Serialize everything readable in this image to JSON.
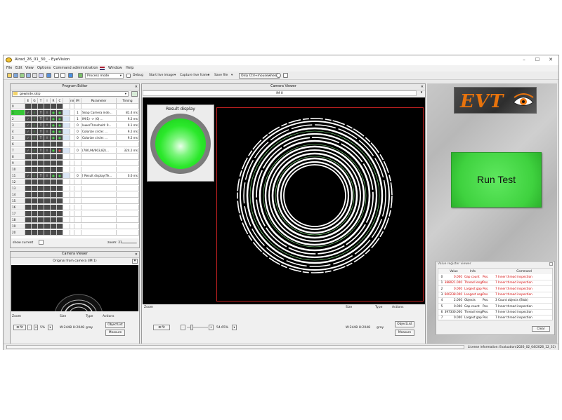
{
  "window": {
    "title": "Alrad_26_01_30_ - EyeVision",
    "controls": [
      "–",
      "☐",
      "✕"
    ]
  },
  "menu": [
    "File",
    "Edit",
    "View",
    "Options",
    "Command administration",
    "Window",
    "Help"
  ],
  "toolbar": {
    "mode_select": "Process mode",
    "debug_label": "Debug",
    "start_live": "Start live image",
    "capture_frame": "Capture live frame",
    "save_file": "Save file",
    "ctrl_mousewheel": "Only Ctrl+mousewheel"
  },
  "program_editor": {
    "title": "Program Editor",
    "file": "gewinde.skip",
    "columns": [
      "E",
      "G",
      "T",
      "I",
      "R",
      "C",
      "nm",
      "IM",
      "Parameter",
      "Timing"
    ],
    "rows": [
      {
        "n": "0",
        "im": "",
        "param": "",
        "timing": ""
      },
      {
        "n": "1",
        "im": "1",
        "param": "Snap Camera inde...",
        "timing": "81.4 ms"
      },
      {
        "n": "2",
        "im": "1",
        "param": "IM(1) -> (0) ...",
        "timing": "9.2 ms"
      },
      {
        "n": "3",
        "im": "0",
        "param": "lowerThreshold: 9...",
        "timing": "0.1 ms"
      },
      {
        "n": "4",
        "im": "0",
        "param": "Colorize circle: ...",
        "timing": "9.2 ms"
      },
      {
        "n": "5",
        "im": "0",
        "param": "Colorize circle: ...",
        "timing": "9.2 ms"
      },
      {
        "n": "6",
        "im": "",
        "param": "",
        "timing": ""
      },
      {
        "n": "7",
        "im": "0",
        "param": "(780,96/603,82)...",
        "timing": "324.2 ms"
      },
      {
        "n": "8",
        "im": "",
        "param": "",
        "timing": ""
      },
      {
        "n": "9",
        "im": "",
        "param": "",
        "timing": ""
      },
      {
        "n": "10",
        "im": "",
        "param": "",
        "timing": ""
      },
      {
        "n": "11",
        "im": "0",
        "param": "[ Result display(Te...",
        "timing": "0.0 ms"
      },
      {
        "n": "12",
        "im": "",
        "param": "",
        "timing": ""
      },
      {
        "n": "13",
        "im": "",
        "param": "",
        "timing": ""
      },
      {
        "n": "14",
        "im": "",
        "param": "",
        "timing": ""
      },
      {
        "n": "15",
        "im": "",
        "param": "",
        "timing": ""
      },
      {
        "n": "16",
        "im": "",
        "param": "",
        "timing": ""
      },
      {
        "n": "17",
        "im": "",
        "param": "",
        "timing": ""
      },
      {
        "n": "18",
        "im": "",
        "param": "",
        "timing": ""
      },
      {
        "n": "19",
        "im": "",
        "param": "",
        "timing": ""
      },
      {
        "n": "20",
        "im": "",
        "param": "",
        "timing": ""
      }
    ],
    "show_current": "show current",
    "zoom": "zoom: 21"
  },
  "small_viewer": {
    "title": "Camera Viewer",
    "subtitle": "Original from camera (IM 1)",
    "zoom_label": "Zoom",
    "zoom_value": "5%",
    "size_label": "Size",
    "size_value": "W:2448  H:2048",
    "type_label": "Type",
    "type_value": "gray",
    "actions_label": "Actions",
    "objectlist": "ObjectList",
    "measure": "Measure",
    "fit": "fit"
  },
  "main_viewer": {
    "title": "Camera Viewer",
    "image_select": "IM 0",
    "result_display": "Result display",
    "zoom_label": "Zoom",
    "zoom_value": "54.65%",
    "size_label": "Size",
    "size_value": "W:2448  H:2048",
    "type_label": "Type",
    "type_value": "gray",
    "actions_label": "Actions",
    "objectlist": "ObjectList",
    "measure": "Measure",
    "fit": "fit"
  },
  "logo_text": "EVT",
  "run_test": "Run Test",
  "value_register": {
    "title": "Value register viewer",
    "columns": [
      "",
      "Value",
      "Info",
      "",
      "Command"
    ],
    "rows": [
      {
        "idx": "0",
        "value": "0.000",
        "info": "Gap count",
        "pos": "Pos.",
        "cmd": "7 Inner thread inspection",
        "red": true
      },
      {
        "idx": "1",
        "value": "388021.000",
        "info": "Thread length",
        "pos": "Pos.",
        "cmd": "7 Inner thread inspection",
        "red": true
      },
      {
        "idx": "2",
        "value": "0.000",
        "info": "Largest gap",
        "pos": "Pos.",
        "cmd": "7 Inner thread inspection",
        "red": true
      },
      {
        "idx": "3",
        "value": "600238.000",
        "info": "Longest segment",
        "pos": "Pos.",
        "cmd": "7 Inner thread inspection",
        "red": true
      },
      {
        "idx": "4",
        "value": "2.000",
        "info": "Objects",
        "pos": "Pos.",
        "cmd": "3 Count objects (Blob)",
        "red": false
      },
      {
        "idx": "5",
        "value": "0.000",
        "info": "Gap count",
        "pos": "Pos.",
        "cmd": "7 Inner thread inspection",
        "red": false
      },
      {
        "idx": "6",
        "value": "397330.000",
        "info": "Thread length",
        "pos": "Pos.",
        "cmd": "7 Inner thread inspection",
        "red": false
      },
      {
        "idx": "7",
        "value": "0.000",
        "info": "Largest gap",
        "pos": "Pos.",
        "cmd": "7 Inner thread inspection",
        "red": false
      }
    ],
    "clear": "Clear"
  },
  "statusbar": {
    "license": "License information: Evaluation(2026_02_04/2026_12_31)"
  },
  "colors": {
    "accent_green": "#3fd23f",
    "result_green": "#2be82b",
    "logo_orange": "#e8730c",
    "error_red": "#d40000"
  }
}
